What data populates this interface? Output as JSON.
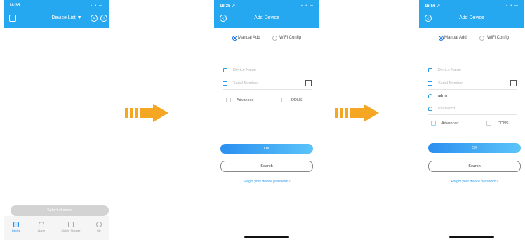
{
  "screens": [
    {
      "status_time": "18:35",
      "title": "Device List ▼",
      "select_channel": "Select channel",
      "tabs": [
        "Device",
        "Alarm",
        "Mobile Storage",
        "Me"
      ]
    },
    {
      "status_time": "18:35 ↗",
      "title": "Add Device",
      "radio_manual": "Manual Add",
      "radio_wifi": "WiFi Config",
      "device_name_placeholder": "Device Name",
      "serial_placeholder": "Serial Number",
      "advanced_label": "Advanced",
      "ddns_label": "DDNS",
      "ok_label": "OK",
      "search_label": "Search",
      "forgot_label": "Forgot your device password?"
    },
    {
      "status_time": "16:56 ↗",
      "title": "Add Device",
      "radio_manual": "Manual Add",
      "radio_wifi": "WiFi Config",
      "device_name_placeholder": "Device Name",
      "serial_placeholder": "Serial Number",
      "username_value": "admin",
      "password_placeholder": "Password",
      "advanced_label": "Advanced",
      "ddns_label": "DDNS",
      "ok_label": "OK",
      "search_label": "Search",
      "forgot_label": "Forgot your device password?"
    }
  ],
  "colors": {
    "accent": "#26a8f1",
    "arrow": "#f5a623",
    "link": "#2d9be9"
  },
  "icons": [
    "menu-icon",
    "search-icon",
    "plus-icon",
    "back-icon",
    "qr-scan-icon",
    "arrow-right-icon"
  ]
}
